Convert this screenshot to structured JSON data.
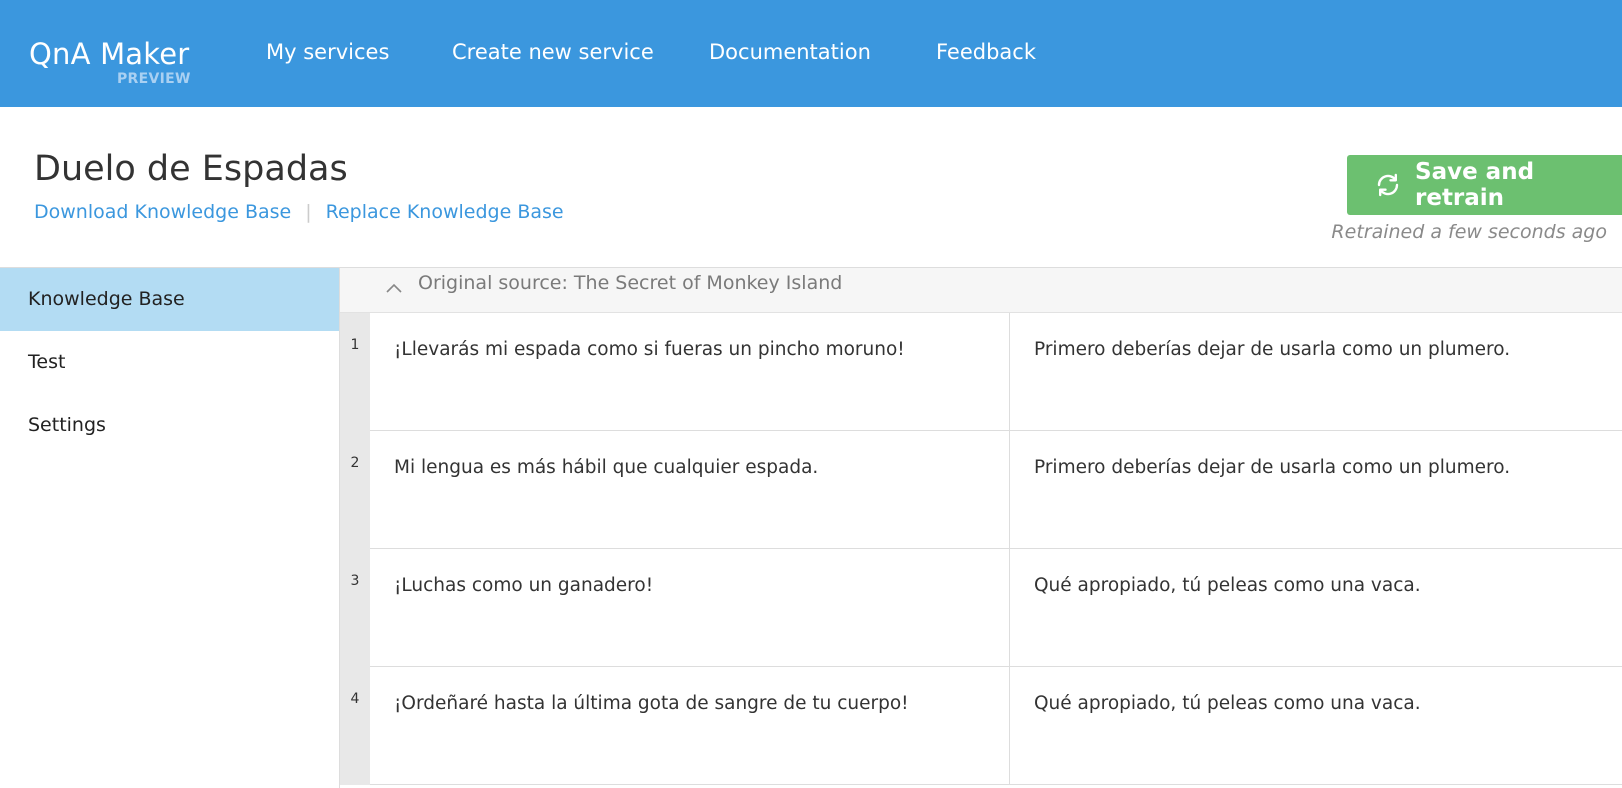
{
  "app": {
    "name": "QnA Maker",
    "tag": "PREVIEW"
  },
  "nav": {
    "items": [
      {
        "label": "My services"
      },
      {
        "label": "Create new service"
      },
      {
        "label": "Documentation"
      },
      {
        "label": "Feedback"
      }
    ]
  },
  "kb": {
    "title": "Duelo de Espadas",
    "download_label": "Download Knowledge Base",
    "separator": "|",
    "replace_label": "Replace Knowledge Base",
    "save_label": "Save and retrain",
    "retrained_status": "Retrained a few seconds ago"
  },
  "sidebar": {
    "items": [
      {
        "label": "Knowledge Base",
        "active": true
      },
      {
        "label": "Test",
        "active": false
      },
      {
        "label": "Settings",
        "active": false
      }
    ]
  },
  "source": {
    "label": "Original source: The Secret of Monkey Island"
  },
  "qna": {
    "rows": [
      {
        "num": "1",
        "question": "¡Llevarás mi espada como si fueras un pincho moruno!",
        "answer": "Primero deberías dejar de usarla como un plumero."
      },
      {
        "num": "2",
        "question": "Mi lengua es más hábil que cualquier espada.",
        "answer": "Primero deberías dejar de usarla como un plumero."
      },
      {
        "num": "3",
        "question": "¡Luchas como un ganadero!",
        "answer": "Qué apropiado, tú peleas como una vaca."
      },
      {
        "num": "4",
        "question": "¡Ordeñaré hasta la última gota de sangre de tu cuerpo!",
        "answer": "Qué apropiado, tú peleas como una vaca."
      }
    ]
  },
  "colors": {
    "header_bg": "#3b97de",
    "link": "#3b97de",
    "save_button": "#6cc070",
    "sidebar_active": "#b3dcf3"
  }
}
